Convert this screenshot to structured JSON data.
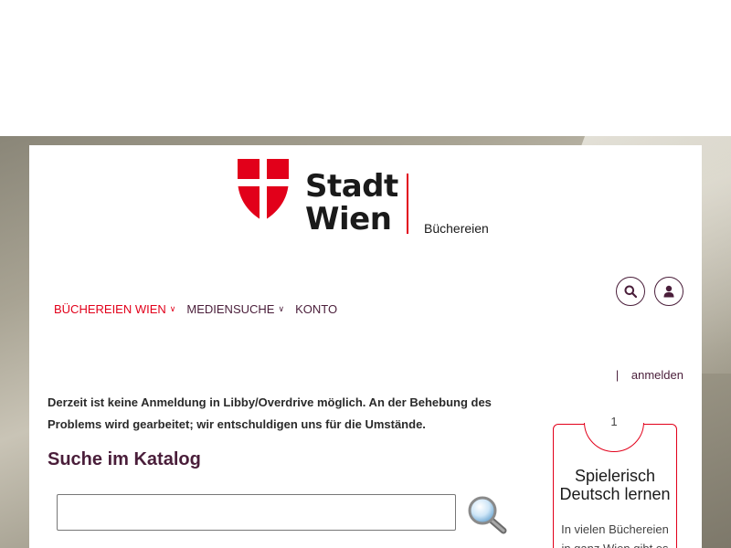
{
  "logo": {
    "line1": "Stadt",
    "line2": "Wien",
    "subtitle": "Büchereien"
  },
  "header": {
    "search_icon": "search-icon",
    "user_icon": "user-icon"
  },
  "nav": {
    "items": [
      {
        "label": "BÜCHEREIEN WIEN",
        "active": true,
        "dropdown": true
      },
      {
        "label": "MEDIENSUCHE",
        "active": false,
        "dropdown": true
      },
      {
        "label": "KONTO",
        "active": false,
        "dropdown": false
      }
    ]
  },
  "login": {
    "separator": "|",
    "label": "anmelden"
  },
  "notice": {
    "text": "Derzeit ist keine Anmeldung in Libby/Overdrive möglich. An der Behebung des Problems wird gearbeitet; wir entschuldigen uns für die Umstände."
  },
  "catalog_search": {
    "heading": "Suche im Katalog",
    "value": "",
    "placeholder": ""
  },
  "card": {
    "number": "1",
    "title": "Spielerisch Deutsch lernen",
    "text": "In vielen Büchereien in ganz Wien gibt es"
  },
  "colors": {
    "brand_red": "#e2001a",
    "brand_purple": "#4a1e3a"
  }
}
